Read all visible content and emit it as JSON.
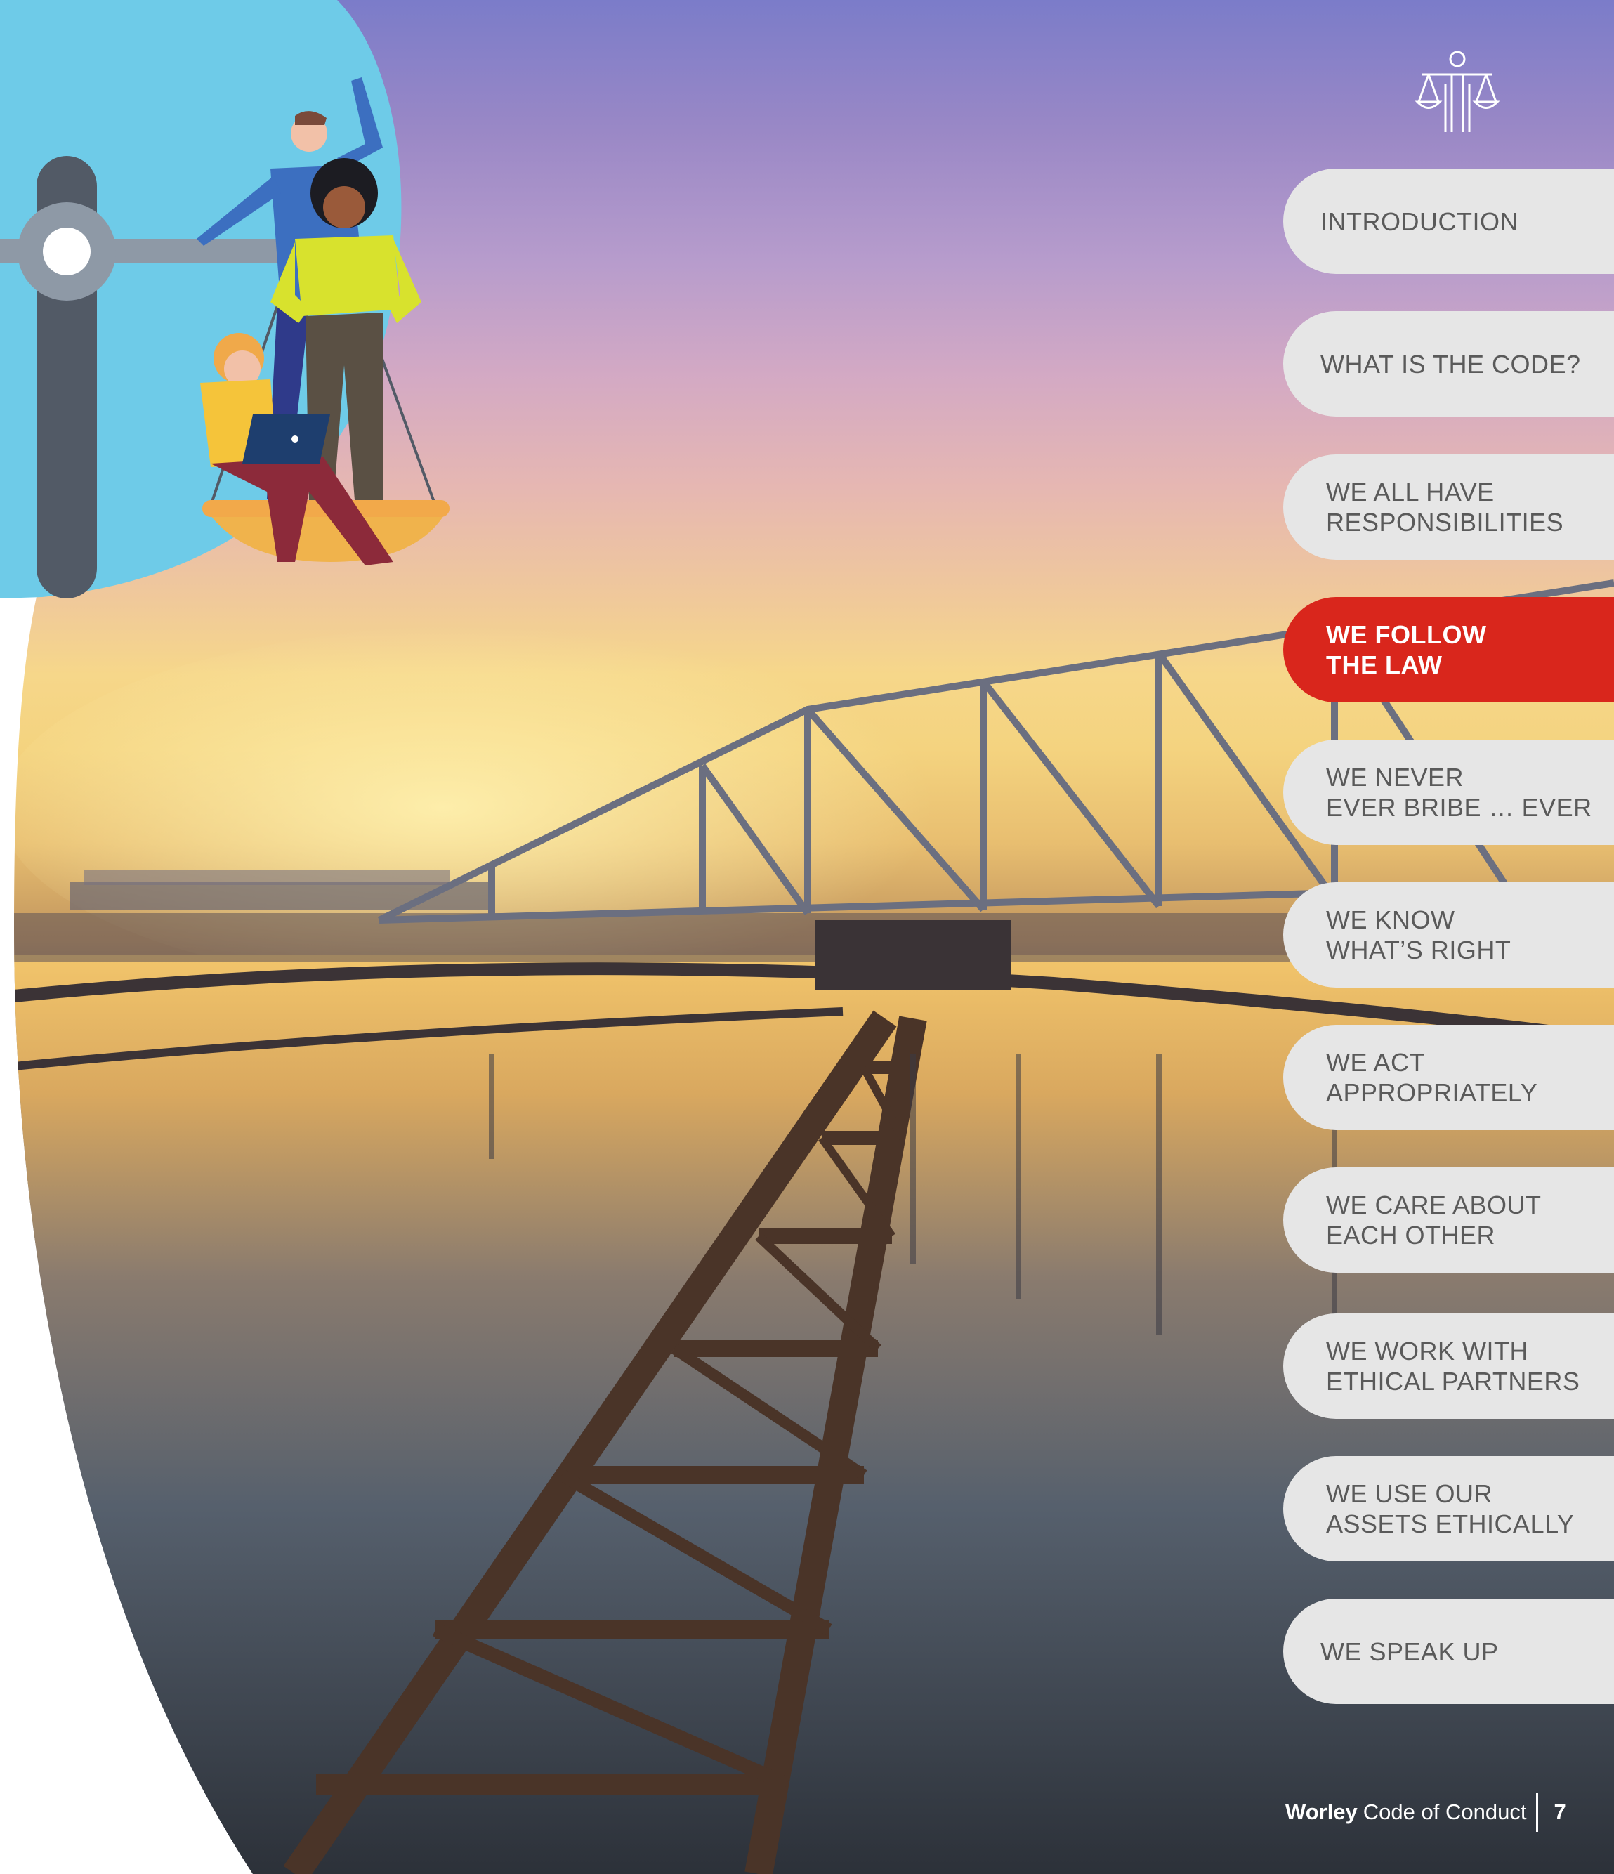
{
  "document": {
    "nav": {
      "tabs": [
        {
          "label": "INTRODUCTION",
          "active": false
        },
        {
          "label": "WHAT IS THE CODE?",
          "active": false
        },
        {
          "label": "WE ALL HAVE\nRESPONSIBILITIES",
          "active": false
        },
        {
          "label": "WE FOLLOW\nTHE LAW",
          "active": true
        },
        {
          "label": "WE NEVER\nEVER BRIBE … EVER",
          "active": false
        },
        {
          "label": "WE KNOW\nWHAT’S RIGHT",
          "active": false
        },
        {
          "label": "WE ACT\nAPPROPRIATELY",
          "active": false
        },
        {
          "label": "WE CARE ABOUT\nEACH OTHER",
          "active": false
        },
        {
          "label": "WE WORK WITH\nETHICAL PARTNERS",
          "active": false
        },
        {
          "label": "WE USE OUR\nASSETS ETHICALLY",
          "active": false
        },
        {
          "label": "WE SPEAK UP",
          "active": false
        }
      ]
    },
    "header_icon": "scales-of-justice-icon",
    "illustration": "people-on-balance-scale-illustration",
    "photo": "water-treatment-plant-at-sunset-photo",
    "footer": {
      "brand": "Worley",
      "title": "Code of Conduct",
      "page_number": "7"
    },
    "colors": {
      "active_tab": "#d9261c",
      "inactive_tab": "#e6e6e6",
      "inactive_text": "#5a5a5a",
      "bubble": "#6ecbe8"
    }
  }
}
